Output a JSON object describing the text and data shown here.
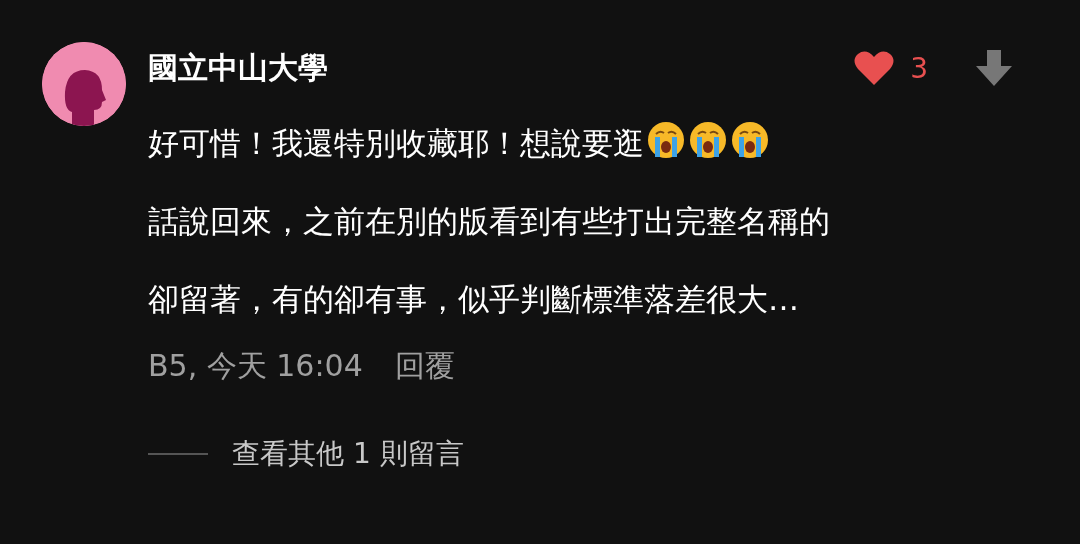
{
  "comment": {
    "author": "國立中山大學",
    "liked": true,
    "like_count": "3",
    "lines": [
      {
        "text": "好可惜！我還特別收藏耶！想說要逛",
        "emojis": [
          {
            "kind": "crying"
          },
          {
            "kind": "crying"
          },
          {
            "kind": "crying"
          }
        ]
      },
      {
        "text": "話說回來，之前在別的版看到有些打出完整名稱的"
      },
      {
        "text": "卻留著，有的卻有事，似乎判斷標準落差很大…"
      }
    ],
    "meta": "B5, 今天 16:04",
    "reply": "回覆",
    "more_replies": "查看其他 1 則留言"
  }
}
